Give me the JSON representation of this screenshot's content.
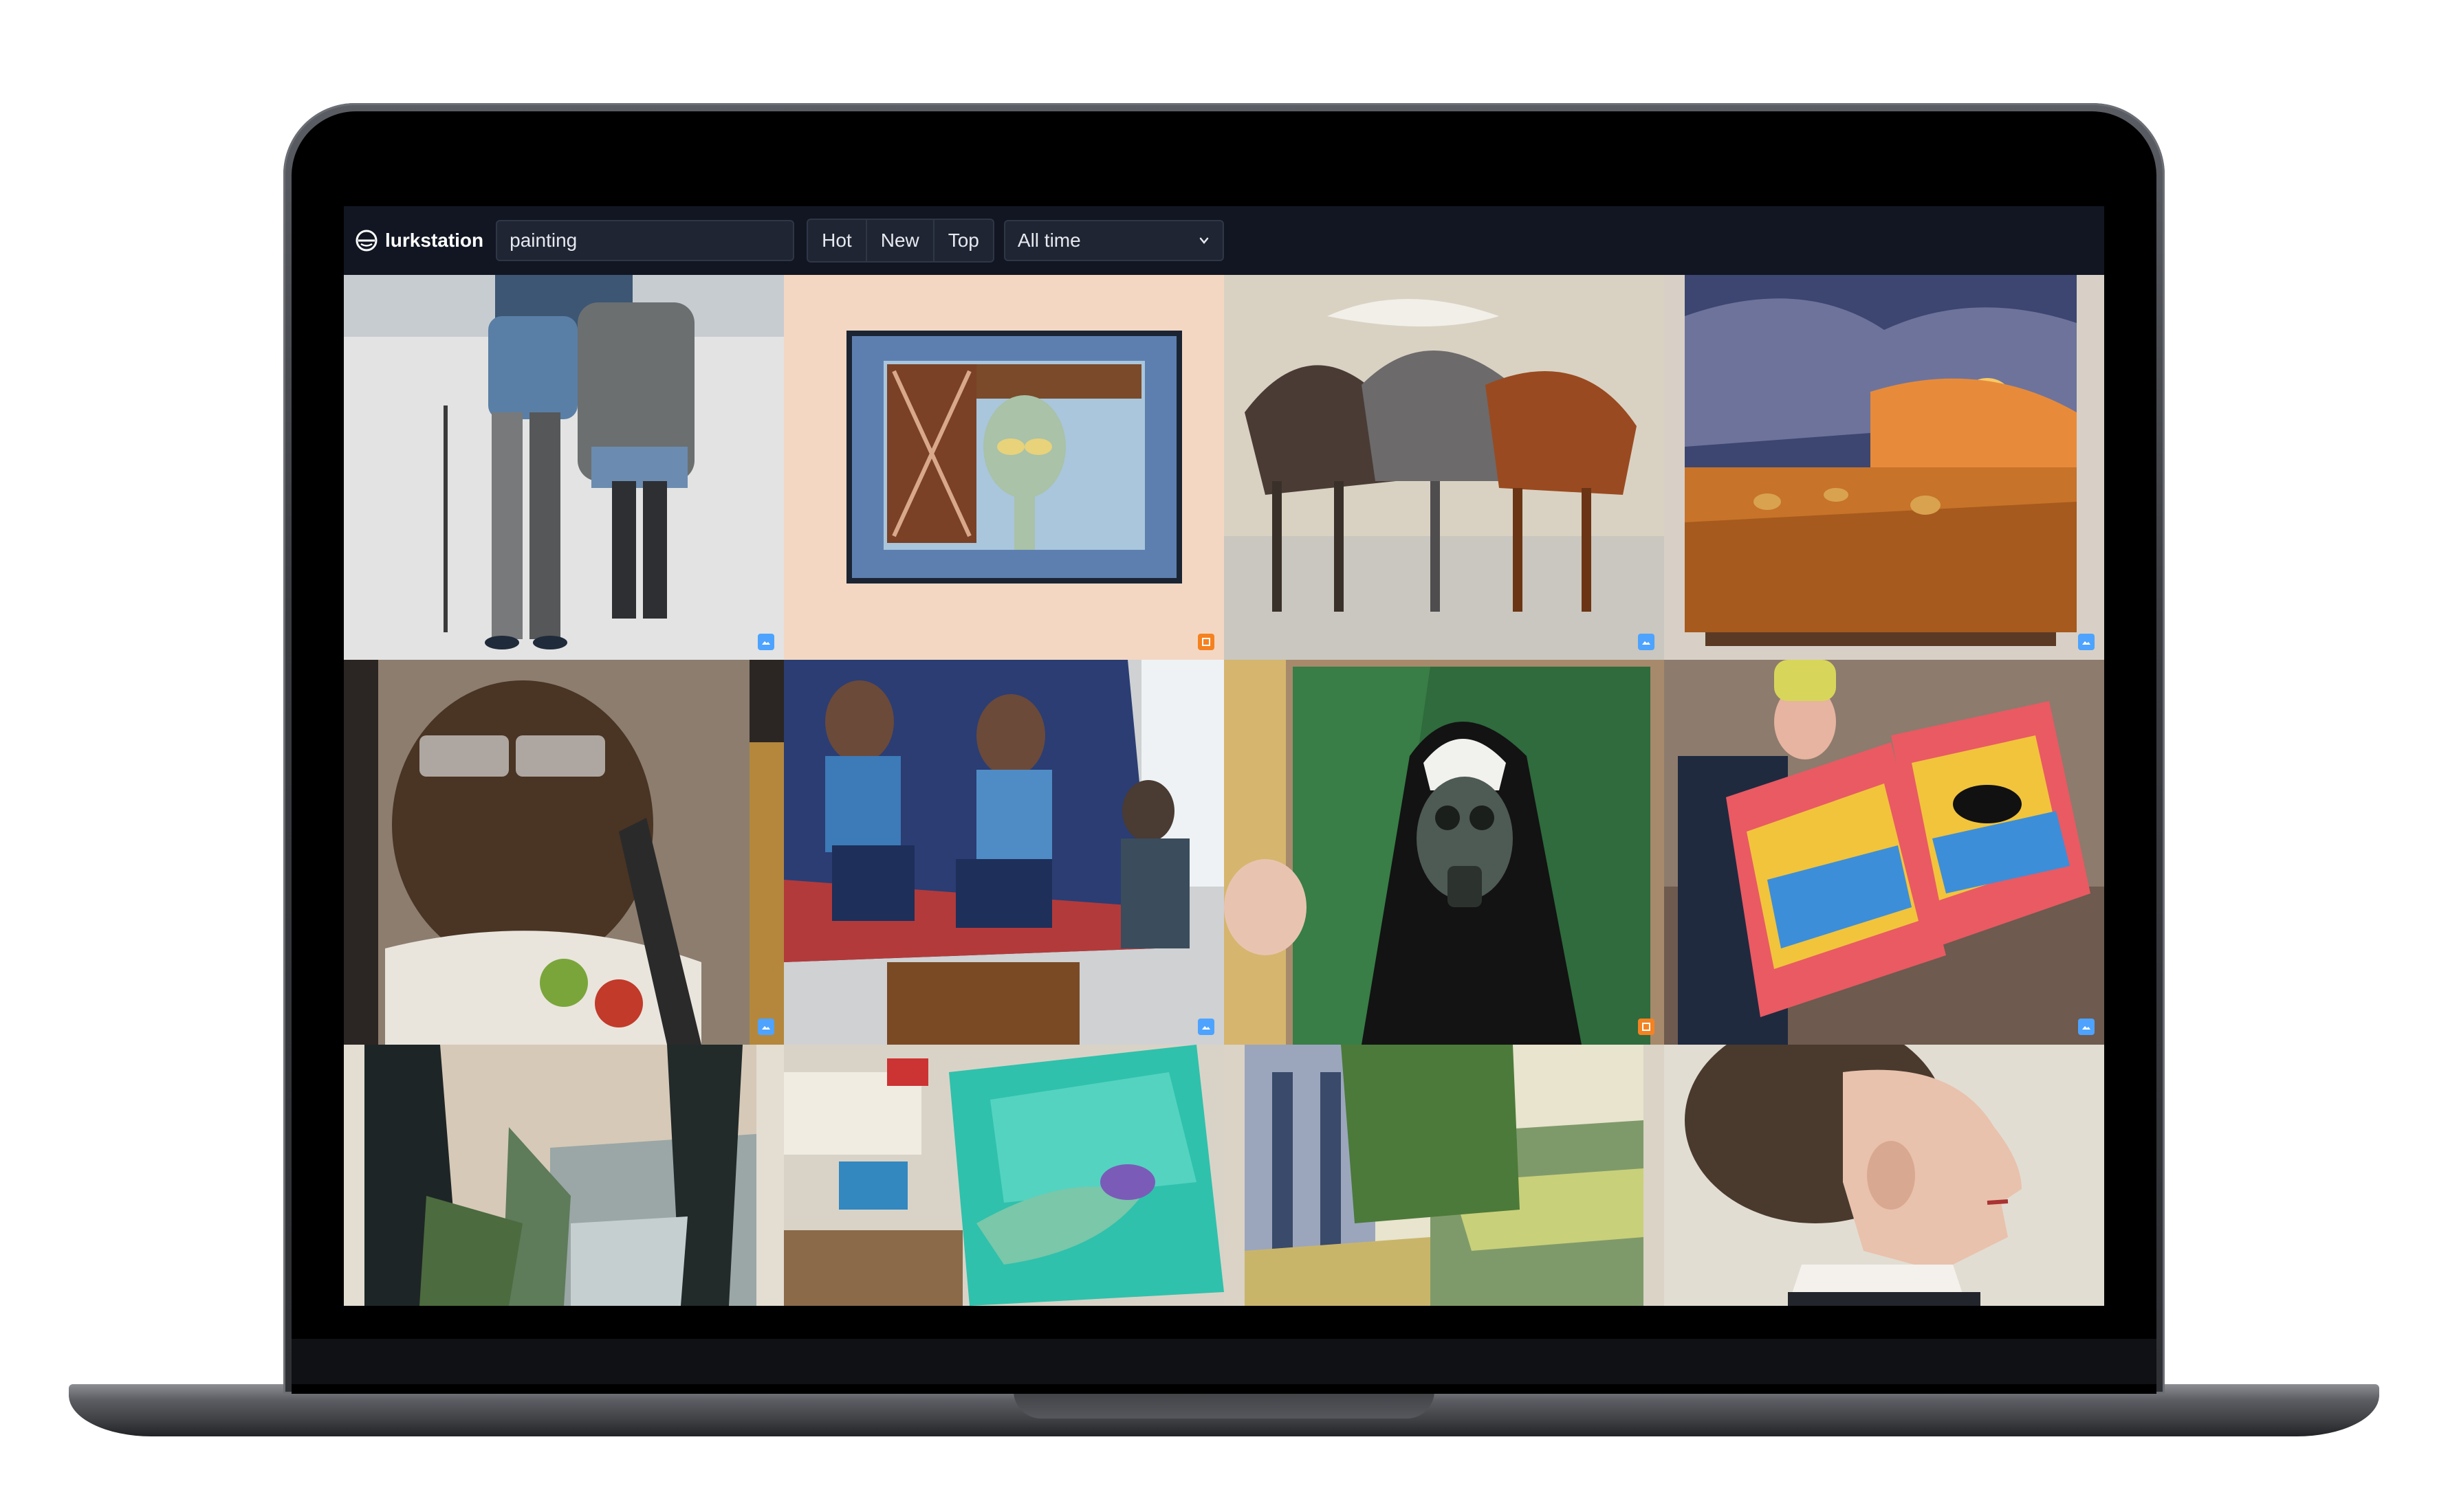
{
  "app": {
    "name": "lurkstation",
    "logo_icon": "lurkstation-logo-icon"
  },
  "search": {
    "value": "painting"
  },
  "sort": {
    "options": [
      "Hot",
      "New",
      "Top"
    ]
  },
  "time_filter": {
    "selected": "All time",
    "icon": "chevron-down-icon"
  },
  "colors": {
    "background": "#111622",
    "control_bg": "#1f2533",
    "control_border": "#2f3646",
    "text": "#e6e9ef",
    "badge_image": "#4da3ff",
    "badge_gallery": "#f58220"
  },
  "grid": {
    "items": [
      {
        "subject": "elderly couple walking in snow watercolor",
        "badge": "image"
      },
      {
        "subject": "squidward window painting",
        "badge": "gallery"
      },
      {
        "subject": "horses oil painting",
        "badge": "image"
      },
      {
        "subject": "sunset wheat field hay bales",
        "badge": "image"
      },
      {
        "subject": "portrait man with glasses",
        "badge": "image"
      },
      {
        "subject": "artist painting self portrait on easel",
        "badge": "image"
      },
      {
        "subject": "nun with gas mask on green",
        "badge": "gallery"
      },
      {
        "subject": "man holding abstract paintings",
        "badge": "image"
      },
      {
        "subject": "coastal forest landscape",
        "badge": "none"
      },
      {
        "subject": "swimmer underwater painting",
        "badge": "none"
      },
      {
        "subject": "trees and valley landscape",
        "badge": "none"
      },
      {
        "subject": "victorian woman profile portrait",
        "badge": "none"
      }
    ]
  }
}
